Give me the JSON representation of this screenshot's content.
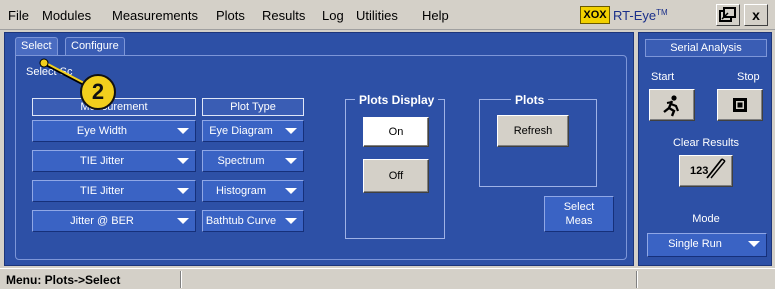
{
  "menubar": {
    "items": [
      "File",
      "Modules",
      "Measurements",
      "Plots",
      "Results",
      "Log",
      "Utilities",
      "Help"
    ],
    "logo_mark": "XOX",
    "logo_text": "RT-Eye",
    "logo_tm": "TM",
    "restore_icon": "restore-icon",
    "close_label": "x"
  },
  "tabs": {
    "select": "Select",
    "configure": "Configure"
  },
  "select_panel": {
    "label": "Select Sc",
    "measurement_header": "Measurement",
    "plot_type_header": "Plot Type",
    "rows": [
      {
        "measurement": "Eye Width",
        "plot": "Eye Diagram"
      },
      {
        "measurement": "TIE Jitter",
        "plot": "Spectrum"
      },
      {
        "measurement": "TIE Jitter",
        "plot": "Histogram"
      },
      {
        "measurement": "Jitter @ BER",
        "plot": "Bathtub Curve"
      }
    ]
  },
  "plots_display": {
    "title": "Plots Display",
    "on_label": "On",
    "off_label": "Off"
  },
  "plots": {
    "title": "Plots",
    "refresh_label": "Refresh"
  },
  "select_meas": {
    "line1": "Select",
    "line2": "Meas"
  },
  "callout": {
    "number": "2"
  },
  "right_panel": {
    "title": "Serial Analysis",
    "start_label": "Start",
    "stop_label": "Stop",
    "clear_results_label": "Clear Results",
    "clear_icon_text": "123",
    "mode_label": "Mode",
    "mode_value": "Single Run"
  },
  "statusbar": {
    "text": "Menu: Plots->Select"
  },
  "colors": {
    "panel": "#2d50a6",
    "dropdown": "#3a63c4",
    "callout": "#f2cf1d",
    "logo": "#f2d100"
  }
}
